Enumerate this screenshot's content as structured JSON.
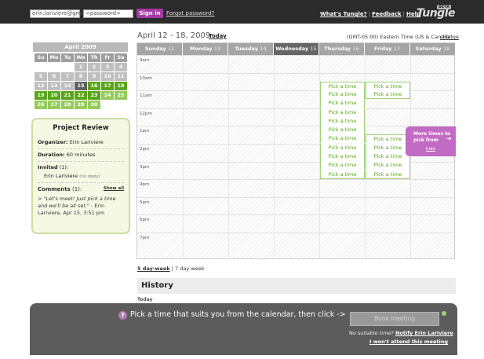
{
  "topbar": {
    "email_value": "erin.lariviere@gma",
    "password_placeholder": "<password>",
    "signin_label": "Sign in",
    "forgot_label": "Forgot password?",
    "links": [
      "What's Tungle?",
      "Feedback",
      "Help"
    ],
    "separator": "|",
    "logo": "Tungle",
    "beta": "BETA"
  },
  "minical": {
    "title": "April 2009",
    "weekdays": [
      "Su",
      "Mo",
      "Tu",
      "We",
      "Th",
      "Fr",
      "Sa"
    ],
    "days": [
      "",
      "",
      "",
      "1",
      "2",
      "3",
      "4",
      "5",
      "6",
      "7",
      "8",
      "9",
      "10",
      "11",
      "12",
      "13",
      "14",
      "15",
      "16",
      "17",
      "18",
      "19",
      "20",
      "21",
      "22",
      "23",
      "24",
      "25",
      "26",
      "27",
      "28",
      "29",
      "30",
      "",
      ""
    ]
  },
  "card": {
    "title": "Project Review",
    "organizer_label": "Organizer:",
    "organizer": "Erin Lariviere",
    "duration_label": "Duration:",
    "duration": "60 minutes",
    "invited_label": "Invited",
    "invited_count": "(1):",
    "invitee": "Erin Lariviere",
    "invitee_status": "(no reply)",
    "comments_label": "Comments",
    "comments_count": "(1):",
    "show_all": "Show all",
    "comment_quote": "\"Let's meet! Just pick a time and we'll be all set.\"",
    "comment_meta": "- Erin Lariviere, Apr 15, 3:51 pm"
  },
  "header": {
    "week_title": "April 12 - 18, 2009",
    "today_link": "Today",
    "timezone": "(GMT-05:00) Eastern Time (US & Canada)",
    "change_link": "change"
  },
  "calendar": {
    "days": [
      {
        "name": "Sunday",
        "num": "12"
      },
      {
        "name": "Monday",
        "num": "13"
      },
      {
        "name": "Tuesday",
        "num": "14"
      },
      {
        "name": "Wednesday",
        "num": "15"
      },
      {
        "name": "Thursday",
        "num": "16"
      },
      {
        "name": "Friday",
        "num": "17"
      },
      {
        "name": "Saturday",
        "num": "18"
      }
    ],
    "hours": [
      "9am",
      "10am",
      "11am",
      "12pm",
      "1pm",
      "2pm",
      "3pm",
      "4pm",
      "5pm",
      "6pm",
      "7pm"
    ],
    "pick_label": "Pick a time",
    "more_times": "More times to pick from",
    "hide_label": "hide",
    "next_icon": "arrow-right-icon"
  },
  "views": {
    "five_day": "5 day-week",
    "separator": "|",
    "seven_day": "7 day-week"
  },
  "history": {
    "title": "History",
    "today": "Today"
  },
  "bottom": {
    "prompt": "Pick a time that suits you from the calendar, then click ->",
    "help_icon": "?",
    "book_label": "Book meeting",
    "no_suitable": "No suitable time?",
    "notify_link": "Notify Erin Lariviere",
    "wont_attend": "I won't attend this meeting"
  }
}
